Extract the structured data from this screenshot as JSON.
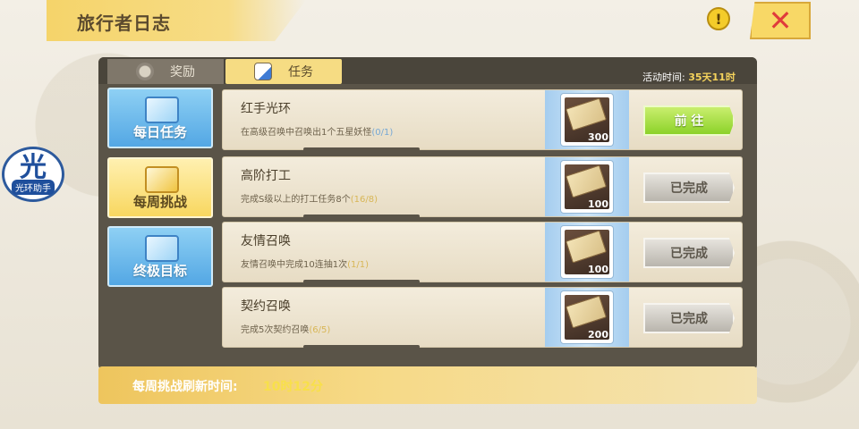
{
  "header": {
    "title": "旅行者日志",
    "info_icon": "exclamation-icon",
    "close_icon": "close-x-icon",
    "info_glyph": "!",
    "close_glyph": "✕"
  },
  "tabs": [
    {
      "label": "奖励",
      "icon": "badge-icon",
      "active": false
    },
    {
      "label": "任务",
      "icon": "notepad-icon",
      "active": true
    }
  ],
  "activity": {
    "label": "活动时间:",
    "value": "35天11时"
  },
  "sidebar": [
    {
      "label": "每日任务",
      "icon": "daily-scroll-icon",
      "active": false
    },
    {
      "label": "每周挑战",
      "icon": "weekly-cards-icon",
      "active": true
    },
    {
      "label": "终极目标",
      "icon": "ultimate-notebook-icon",
      "active": false
    }
  ],
  "helper": {
    "big": "光",
    "small": "光环助手"
  },
  "tasks": [
    {
      "name": "红手光环",
      "desc": "在高级召唤中召唤出1个五星妖怪",
      "progress": "(0/1)",
      "reward_count": "300",
      "action": "前 往",
      "status": "go"
    },
    {
      "name": "高阶打工",
      "desc": "完成S级以上的打工任务8个",
      "progress": "(16/8)",
      "reward_count": "100",
      "action": "已完成",
      "status": "done"
    },
    {
      "name": "友情召唤",
      "desc": "友情召唤中完成10连抽1次",
      "progress": "(1/1)",
      "reward_count": "100",
      "action": "已完成",
      "status": "done"
    },
    {
      "name": "契约召唤",
      "desc": "完成5次契约召唤",
      "progress": "(6/5)",
      "reward_count": "200",
      "action": "已完成",
      "status": "done"
    }
  ],
  "footer": {
    "label": "每周挑战刷新时间:",
    "value": "10时12分"
  },
  "colors": {
    "accent_yellow": "#f6dc83",
    "go_green": "#8cd229",
    "panel_dark": "#5a5448"
  }
}
